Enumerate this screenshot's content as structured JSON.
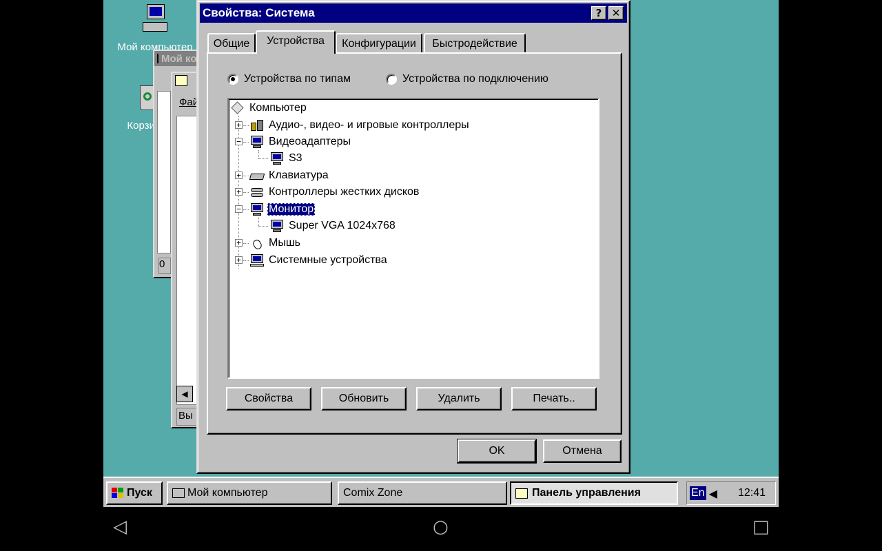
{
  "desktop": {
    "icons": [
      {
        "label": "Мой компьютер",
        "icon": "my-computer-icon"
      },
      {
        "label": "Корзина",
        "icon": "recycle-bin-icon"
      }
    ],
    "bg_windows": [
      {
        "title": "Мой компьютер",
        "menu_label": "Ф",
        "status": "0"
      },
      {
        "title": "Панель управления",
        "menu_label": "Файл",
        "status": "Вы"
      }
    ]
  },
  "dialog": {
    "title": "Свойства: Система",
    "help_button": "?",
    "close_button": "✕",
    "tabs": [
      {
        "label": "Общие",
        "active": false
      },
      {
        "label": "Устройства",
        "active": true
      },
      {
        "label": "Конфигурации",
        "active": false
      },
      {
        "label": "Быстродействие",
        "active": false
      }
    ],
    "radio_by_type": "Устройства по типам",
    "radio_by_connection": "Устройства по подключению",
    "tree": [
      {
        "label": "Компьютер",
        "icon": "computer-icon",
        "level": 0,
        "expander": "",
        "selected": false
      },
      {
        "label": "Аудио-, видео- и игровые контроллеры",
        "icon": "multimedia-icon",
        "level": 1,
        "expander": "+",
        "selected": false
      },
      {
        "label": "Видеоадаптеры",
        "icon": "display-adapter-icon",
        "level": 1,
        "expander": "−",
        "selected": false
      },
      {
        "label": "S3",
        "icon": "display-adapter-icon",
        "level": 2,
        "expander": "",
        "selected": false
      },
      {
        "label": "Клавиатура",
        "icon": "keyboard-icon",
        "level": 1,
        "expander": "+",
        "selected": false
      },
      {
        "label": "Контроллеры жестких дисков",
        "icon": "hard-disk-controller-icon",
        "level": 1,
        "expander": "+",
        "selected": false
      },
      {
        "label": "Монитор",
        "icon": "monitor-icon",
        "level": 1,
        "expander": "−",
        "selected": true
      },
      {
        "label": "Super VGA 1024x768",
        "icon": "monitor-icon",
        "level": 2,
        "expander": "",
        "selected": false
      },
      {
        "label": "Мышь",
        "icon": "mouse-icon",
        "level": 1,
        "expander": "+",
        "selected": false
      },
      {
        "label": "Системные устройства",
        "icon": "system-devices-icon",
        "level": 1,
        "expander": "+",
        "selected": false
      }
    ],
    "buttons": {
      "properties": "Свойства",
      "refresh": "Обновить",
      "remove": "Удалить",
      "print": "Печать.."
    },
    "ok": "OK",
    "cancel": "Отмена"
  },
  "taskbar": {
    "start": "Пуск",
    "tasks": [
      {
        "label": "Мой компьютер",
        "pressed": false
      },
      {
        "label": "Comix Zone",
        "pressed": false
      },
      {
        "label": "Панель управления",
        "pressed": true
      }
    ],
    "lang": "En",
    "clock": "12:41"
  },
  "colors": {
    "desktop": "#55aaaa",
    "titlebar_active": "#000080",
    "face": "#c0c0c0"
  }
}
